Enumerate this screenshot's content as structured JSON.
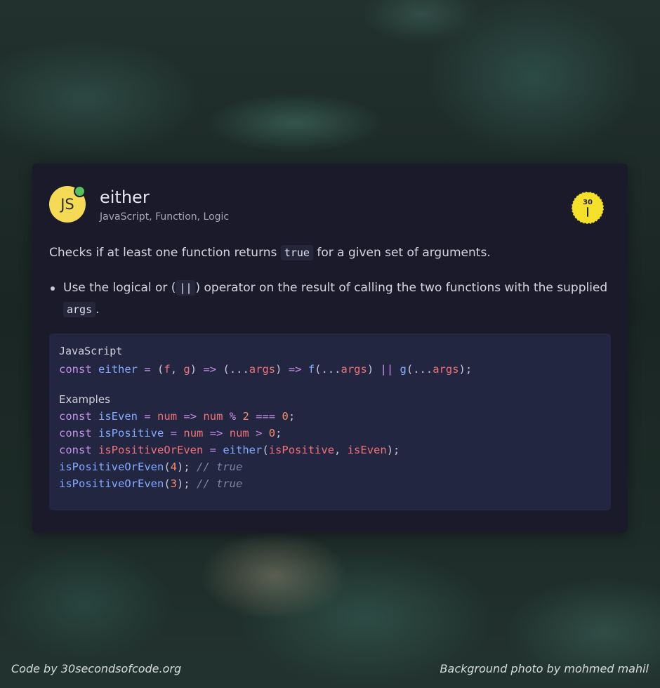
{
  "snippet": {
    "badge": "JS",
    "title": "either",
    "tags": "JavaScript, Function, Logic",
    "logo_number": "30",
    "description": {
      "before": "Checks if at least one function returns ",
      "code": "true",
      "after": " for a given set of arguments."
    },
    "bullet": {
      "before": "Use the logical or (",
      "code1": "||",
      "middle": ") operator on the result of calling the two functions with the supplied ",
      "code2": "args",
      "after": "."
    }
  },
  "code": {
    "language": "JavaScript",
    "definition": {
      "t0": "const",
      "t1": "either",
      "t2": "=",
      "t3": "(",
      "t4": "f",
      "t5": ",",
      "t6": "g",
      "t7": ")",
      "t8": "=>",
      "t9": "(...",
      "t10": "args",
      "t11": ")",
      "t12": "=>",
      "t13": "f",
      "t14": "(...",
      "t15": "args",
      "t16": ")",
      "t17": "||",
      "t18": "g",
      "t19": "(...",
      "t20": "args",
      "t21": ");"
    },
    "examples_label": "Examples",
    "examples": {
      "l1": {
        "kw": "const",
        "name": "isEven",
        "eq": "=",
        "p": "num",
        "arrow": "=>",
        "v": "num",
        "op": "%",
        "n1": "2",
        "op2": "===",
        "n2": "0",
        "end": ";"
      },
      "l2": {
        "kw": "const",
        "name": "isPositive",
        "eq": "=",
        "p": "num",
        "arrow": "=>",
        "v": "num",
        "op": ">",
        "n": "0",
        "end": ";"
      },
      "l3": {
        "kw": "const",
        "name": "isPositiveOrEven",
        "eq": "=",
        "fn": "either",
        "open": "(",
        "a1": "isPositive",
        "comma": ",",
        "a2": "isEven",
        "end": ");"
      },
      "l4": {
        "fn": "isPositiveOrEven",
        "open": "(",
        "n": "4",
        "close": ");",
        "comment": "// true"
      },
      "l5": {
        "fn": "isPositiveOrEven",
        "open": "(",
        "n": "3",
        "close": ");",
        "comment": "// true"
      }
    }
  },
  "footer": {
    "left": "Code by 30secondsofcode.org",
    "right": "Background photo by mohmed mahil"
  },
  "colors": {
    "card_bg": "#1b1a2a",
    "code_bg": "#232640",
    "js_yellow": "#f5da55",
    "online_green": "#55c05a",
    "keyword": "#c792ea",
    "function": "#82aaff",
    "variable": "#f07178",
    "number": "#f78c6c"
  }
}
